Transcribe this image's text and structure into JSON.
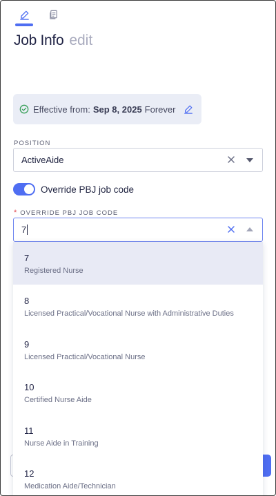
{
  "header": {
    "tabs": [
      {
        "icon": "edit-icon",
        "active": true
      },
      {
        "icon": "document-icon",
        "active": false
      }
    ],
    "title": "Job Info",
    "title_suffix": "edit"
  },
  "effective": {
    "prefix": "Effective from:",
    "date": "Sep 8, 2025",
    "until": "Forever"
  },
  "position": {
    "label": "POSITION",
    "value": "ActiveAide"
  },
  "override_toggle": {
    "label": "Override PBJ job code",
    "on": true
  },
  "override_field": {
    "required_mark": "*",
    "label": "OVERRIDE PBJ JOB CODE",
    "value": "7"
  },
  "options": [
    {
      "code": "7",
      "desc": "Registered Nurse"
    },
    {
      "code": "8",
      "desc": "Licensed Practical/Vocational Nurse with Administrative Duties"
    },
    {
      "code": "9",
      "desc": "Licensed Practical/Vocational Nurse"
    },
    {
      "code": "10",
      "desc": "Certified Nurse Aide"
    },
    {
      "code": "11",
      "desc": "Nurse Aide in Training"
    },
    {
      "code": "12",
      "desc": "Medication Aide/Technician"
    }
  ],
  "colors": {
    "accent": "#4f6ef2",
    "active_option_bg": "#e8eaf5",
    "effective_bg": "#eaedf6"
  }
}
